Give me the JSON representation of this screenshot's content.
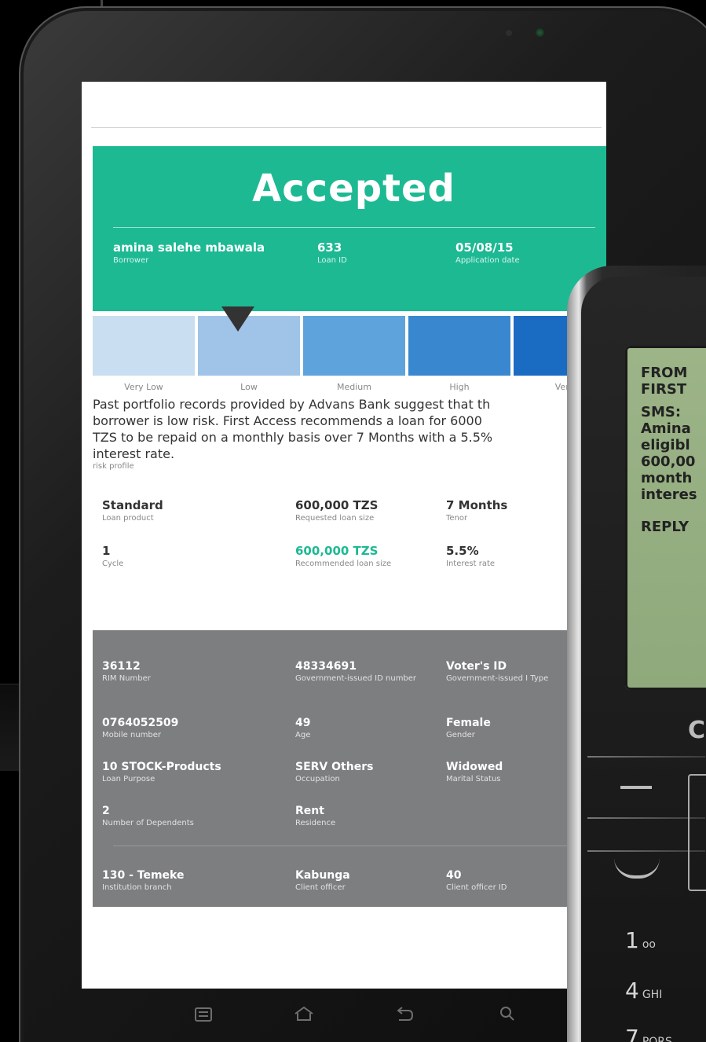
{
  "hero": {
    "status": "Accepted",
    "fields": [
      {
        "value": "amina salehe mbawala",
        "label": "Borrower"
      },
      {
        "value": "633",
        "label": "Loan ID"
      },
      {
        "value": "05/08/15",
        "label": "Application date"
      }
    ]
  },
  "risk_scale": {
    "levels": [
      "Very Low",
      "Low",
      "Medium",
      "High",
      "Very"
    ],
    "selected": "Low",
    "colors": [
      "#c9def0",
      "#9fc4e7",
      "#5ea3dc",
      "#3988cf",
      "#1a6bc2"
    ]
  },
  "summary": {
    "text": "Past portfolio records provided by Advans Bank suggest that th borrower is low risk. First Access recommends a loan for 6000 TZS to be repaid on a monthly basis over 7 Months with a 5.5% interest rate.",
    "lines": [
      "Past portfolio records provided by Advans Bank suggest that th",
      "borrower is low risk. First Access recommends a loan for 6000",
      "TZS to be repaid on a monthly basis over 7 Months with a 5.5%",
      "interest rate."
    ],
    "label": "risk profile"
  },
  "loan": [
    {
      "value": "Standard",
      "label": "Loan product"
    },
    {
      "value": "600,000 TZS",
      "label": "Requested loan size"
    },
    {
      "value": "7 Months",
      "label": "Tenor"
    },
    {
      "value": "1",
      "label": "Cycle"
    },
    {
      "value": "600,000 TZS",
      "label": "Recommended loan size"
    },
    {
      "value": "5.5%",
      "label": "Interest rate"
    }
  ],
  "details": [
    {
      "value": "36112",
      "label": "RIM Number"
    },
    {
      "value": "48334691",
      "label": "Government-issued ID number"
    },
    {
      "value": "Voter's ID",
      "label": "Government-issued I Type"
    },
    {
      "value": "0764052509",
      "label": "Mobile number"
    },
    {
      "value": "49",
      "label": "Age"
    },
    {
      "value": "Female",
      "label": "Gender"
    },
    {
      "value": "10 STOCK-Products",
      "label": "Loan Purpose"
    },
    {
      "value": "SERV Others",
      "label": "Occupation"
    },
    {
      "value": "Widowed",
      "label": "Marital Status"
    },
    {
      "value": "2",
      "label": "Number of Dependents"
    },
    {
      "value": "Rent",
      "label": "Residence"
    }
  ],
  "institution": [
    {
      "value": "130 - Temeke",
      "label": "Institution branch"
    },
    {
      "value": "Kabunga",
      "label": "Client officer"
    },
    {
      "value": "40",
      "label": "Client officer ID"
    }
  ],
  "nav_icons": [
    "menu-icon",
    "home-icon",
    "back-icon",
    "search-icon"
  ],
  "sms": {
    "from_label": "FROM",
    "from_name": "FIRST",
    "sms_label": "SMS:",
    "body_lines": [
      "Amina",
      "eligibl",
      "600,00",
      "month",
      "interes"
    ],
    "reply": "REPLY"
  },
  "keypad": [
    {
      "digit": "1",
      "letters": "ᴏᴏ"
    },
    {
      "digit": "4",
      "letters": "GHI"
    },
    {
      "digit": "7",
      "letters": "PQRS"
    }
  ],
  "brand_fragment": "C"
}
